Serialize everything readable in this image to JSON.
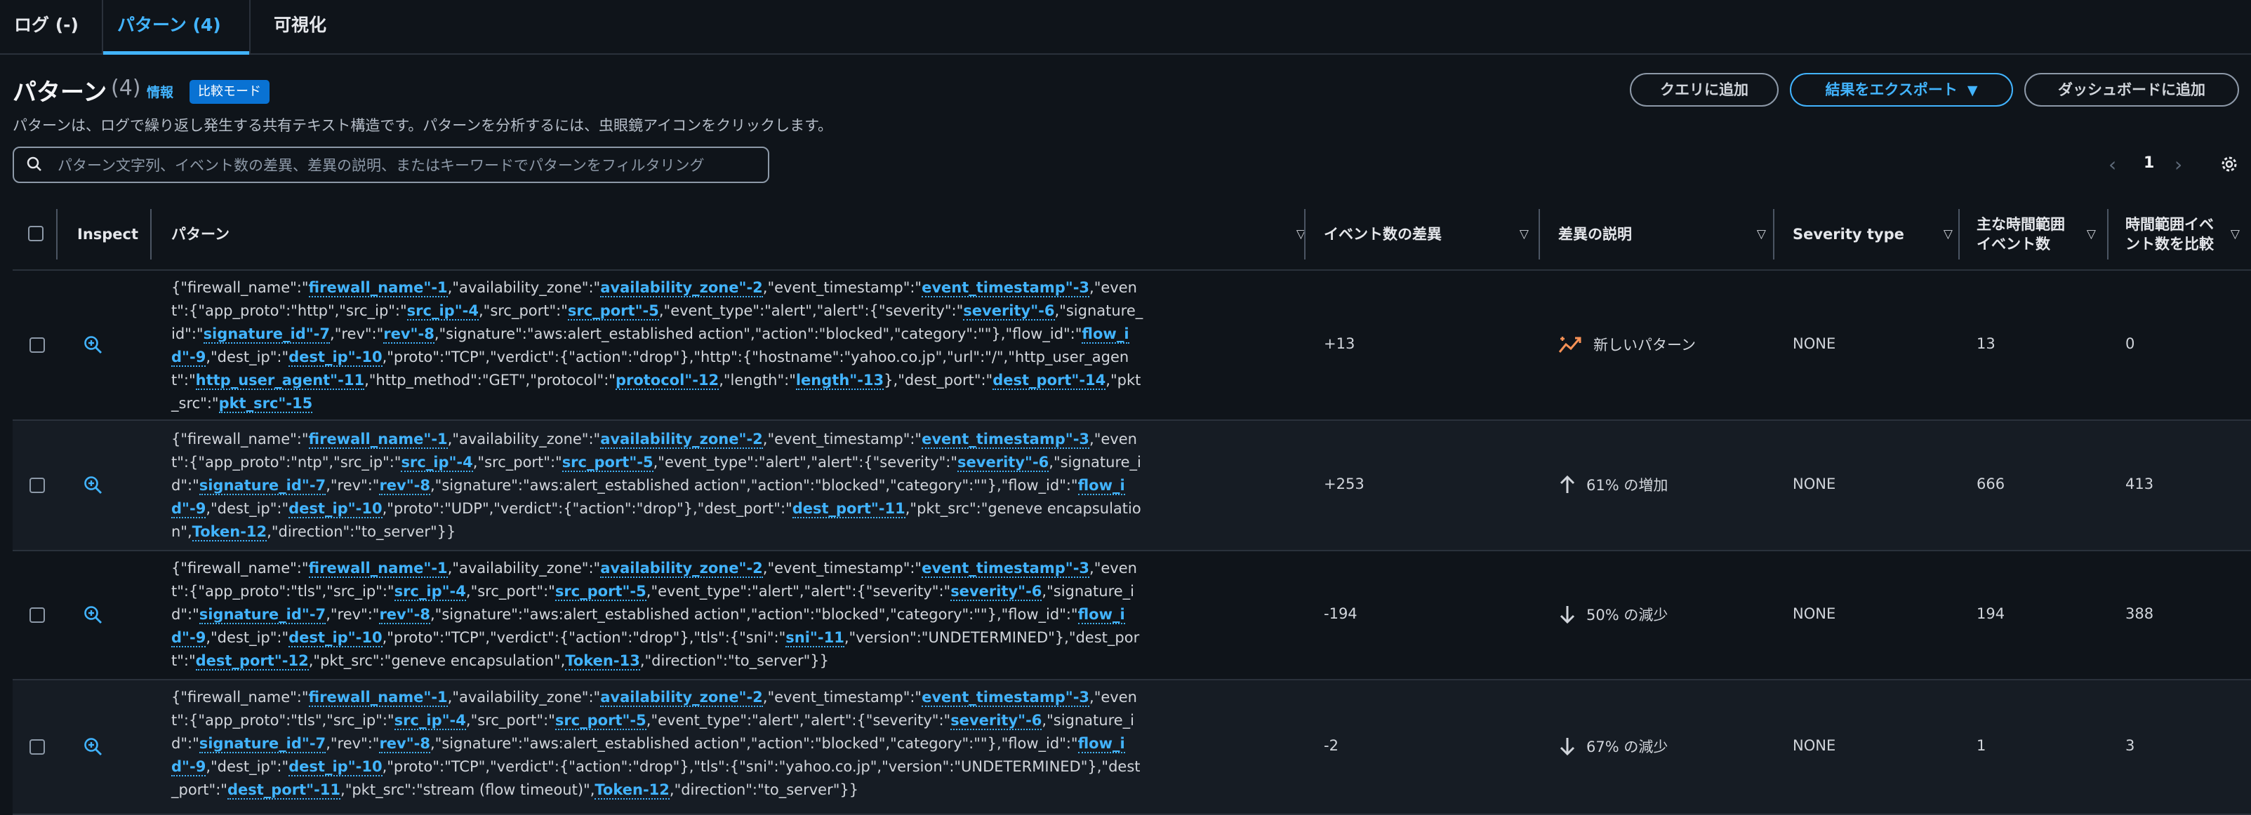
{
  "tabs": [
    {
      "label": "ログ (-)"
    },
    {
      "label": "パターン (4)"
    },
    {
      "label": "可視化"
    }
  ],
  "header": {
    "title": "パターン",
    "count": "(4)",
    "info": "情報",
    "compare_badge": "比較モード",
    "description": "パターンは、ログで繰り返し発生する共有テキスト構造です。パターンを分析するには、虫眼鏡アイコンをクリックします。"
  },
  "actions": {
    "add_query": "クエリに追加",
    "export": "結果をエクスポート",
    "add_dashboard": "ダッシュボードに追加"
  },
  "search": {
    "placeholder": "パターン文字列、イベント数の差異、差異の説明、またはキーワードでパターンをフィルタリング"
  },
  "pagination": {
    "current": "1"
  },
  "columns": {
    "inspect": "Inspect",
    "pattern": "パターン",
    "event_diff": "イベント数の差異",
    "diff_desc": "差異の説明",
    "severity": "Severity type",
    "main_count": "主な時間範囲イベント数",
    "compare_count": "時間範囲イベント数を比較"
  },
  "rows": [
    {
      "pattern": [
        {
          "t": "{\"firewall_name\":\""
        },
        {
          "k": "firewall_name\"-1"
        },
        {
          "t": ",\"availability_zone\":\""
        },
        {
          "k": "availability_zone\"-2"
        },
        {
          "t": ",\"event_timestamp\":\""
        },
        {
          "k": "event_timestamp\"-3"
        },
        {
          "t": ",\"event\":{\"app_proto\":\"http\",\"src_ip\":\""
        },
        {
          "k": "src_ip\"-4"
        },
        {
          "t": ",\"src_port\":\""
        },
        {
          "k": "src_port\"-5"
        },
        {
          "t": ",\"event_type\":\"alert\",\"alert\":{\"severity\":\""
        },
        {
          "k": "severity\"-6"
        },
        {
          "t": ",\"signature_id\":\""
        },
        {
          "k": "signature_id\"-7"
        },
        {
          "t": ",\"rev\":\""
        },
        {
          "k": "rev\"-8"
        },
        {
          "t": ",\"signature\":\"aws:alert_established action\",\"action\":\"blocked\",\"category\":\"\"},\"flow_id\":\""
        },
        {
          "k": "flow_id\"-9"
        },
        {
          "t": ",\"dest_ip\":\""
        },
        {
          "k": "dest_ip\"-10"
        },
        {
          "t": ",\"proto\":\"TCP\",\"verdict\":{\"action\":\"drop\"},\"http\":{\"hostname\":\"yahoo.co.jp\",\"url\":\"/\",\"http_user_agent\":\""
        },
        {
          "k": "http_user_agent\"-11"
        },
        {
          "t": ",\"http_method\":\"GET\",\"protocol\":\""
        },
        {
          "k": "protocol\"-12"
        },
        {
          "t": ",\"length\":\""
        },
        {
          "k": "length\"-13"
        },
        {
          "t": "},\"dest_port\":\""
        },
        {
          "k": "dest_port\"-14"
        },
        {
          "t": ",\"pkt_src\":\""
        },
        {
          "k": "pkt_src\"-15"
        }
      ],
      "event_diff": "+13",
      "trend": "new",
      "diff_desc": "新しいパターン",
      "severity": "NONE",
      "main_count": "13",
      "compare_count": "0"
    },
    {
      "pattern": [
        {
          "t": "{\"firewall_name\":\""
        },
        {
          "k": "firewall_name\"-1"
        },
        {
          "t": ",\"availability_zone\":\""
        },
        {
          "k": "availability_zone\"-2"
        },
        {
          "t": ",\"event_timestamp\":\""
        },
        {
          "k": "event_timestamp\"-3"
        },
        {
          "t": ",\"event\":{\"app_proto\":\"ntp\",\"src_ip\":\""
        },
        {
          "k": "src_ip\"-4"
        },
        {
          "t": ",\"src_port\":\""
        },
        {
          "k": "src_port\"-5"
        },
        {
          "t": ",\"event_type\":\"alert\",\"alert\":{\"severity\":\""
        },
        {
          "k": "severity\"-6"
        },
        {
          "t": ",\"signature_id\":\""
        },
        {
          "k": "signature_id\"-7"
        },
        {
          "t": ",\"rev\":\""
        },
        {
          "k": "rev\"-8"
        },
        {
          "t": ",\"signature\":\"aws:alert_established action\",\"action\":\"blocked\",\"category\":\"\"},\"flow_id\":\""
        },
        {
          "k": "flow_id\"-9"
        },
        {
          "t": ",\"dest_ip\":\""
        },
        {
          "k": "dest_ip\"-10"
        },
        {
          "t": ",\"proto\":\"UDP\",\"verdict\":{\"action\":\"drop\"},\"dest_port\":\""
        },
        {
          "k": "dest_port\"-11"
        },
        {
          "t": ",\"pkt_src\":\"geneve encapsulation\","
        },
        {
          "k": "Token-12"
        },
        {
          "t": ",\"direction\":\"to_server\"}}"
        }
      ],
      "event_diff": "+253",
      "trend": "up",
      "diff_desc": "61% の増加",
      "severity": "NONE",
      "main_count": "666",
      "compare_count": "413"
    },
    {
      "pattern": [
        {
          "t": "{\"firewall_name\":\""
        },
        {
          "k": "firewall_name\"-1"
        },
        {
          "t": ",\"availability_zone\":\""
        },
        {
          "k": "availability_zone\"-2"
        },
        {
          "t": ",\"event_timestamp\":\""
        },
        {
          "k": "event_timestamp\"-3"
        },
        {
          "t": ",\"event\":{\"app_proto\":\"tls\",\"src_ip\":\""
        },
        {
          "k": "src_ip\"-4"
        },
        {
          "t": ",\"src_port\":\""
        },
        {
          "k": "src_port\"-5"
        },
        {
          "t": ",\"event_type\":\"alert\",\"alert\":{\"severity\":\""
        },
        {
          "k": "severity\"-6"
        },
        {
          "t": ",\"signature_id\":\""
        },
        {
          "k": "signature_id\"-7"
        },
        {
          "t": ",\"rev\":\""
        },
        {
          "k": "rev\"-8"
        },
        {
          "t": ",\"signature\":\"aws:alert_established action\",\"action\":\"blocked\",\"category\":\"\"},\"flow_id\":\""
        },
        {
          "k": "flow_id\"-9"
        },
        {
          "t": ",\"dest_ip\":\""
        },
        {
          "k": "dest_ip\"-10"
        },
        {
          "t": ",\"proto\":\"TCP\",\"verdict\":{\"action\":\"drop\"},\"tls\":{\"sni\":\""
        },
        {
          "k": "sni\"-11"
        },
        {
          "t": ",\"version\":\"UNDETERMINED\"},\"dest_port\":\""
        },
        {
          "k": "dest_port\"-12"
        },
        {
          "t": ",\"pkt_src\":\"geneve encapsulation\","
        },
        {
          "k": "Token-13"
        },
        {
          "t": ",\"direction\":\"to_server\"}}"
        }
      ],
      "event_diff": "-194",
      "trend": "down",
      "diff_desc": "50% の減少",
      "severity": "NONE",
      "main_count": "194",
      "compare_count": "388"
    },
    {
      "pattern": [
        {
          "t": "{\"firewall_name\":\""
        },
        {
          "k": "firewall_name\"-1"
        },
        {
          "t": ",\"availability_zone\":\""
        },
        {
          "k": "availability_zone\"-2"
        },
        {
          "t": ",\"event_timestamp\":\""
        },
        {
          "k": "event_timestamp\"-3"
        },
        {
          "t": ",\"event\":{\"app_proto\":\"tls\",\"src_ip\":\""
        },
        {
          "k": "src_ip\"-4"
        },
        {
          "t": ",\"src_port\":\""
        },
        {
          "k": "src_port\"-5"
        },
        {
          "t": ",\"event_type\":\"alert\",\"alert\":{\"severity\":\""
        },
        {
          "k": "severity\"-6"
        },
        {
          "t": ",\"signature_id\":\""
        },
        {
          "k": "signature_id\"-7"
        },
        {
          "t": ",\"rev\":\""
        },
        {
          "k": "rev\"-8"
        },
        {
          "t": ",\"signature\":\"aws:alert_established action\",\"action\":\"blocked\",\"category\":\"\"},\"flow_id\":\""
        },
        {
          "k": "flow_id\"-9"
        },
        {
          "t": ",\"dest_ip\":\""
        },
        {
          "k": "dest_ip\"-10"
        },
        {
          "t": ",\"proto\":\"TCP\",\"verdict\":{\"action\":\"drop\"},\"tls\":{\"sni\":\"yahoo.co.jp\",\"version\":\"UNDETERMINED\"},\"dest_port\":\""
        },
        {
          "k": "dest_port\"-11"
        },
        {
          "t": ",\"pkt_src\":\"stream (flow timeout)\","
        },
        {
          "k": "Token-12"
        },
        {
          "t": ",\"direction\":\"to_server\"}}"
        }
      ],
      "event_diff": "-2",
      "trend": "down",
      "diff_desc": "67% の減少",
      "severity": "NONE",
      "main_count": "1",
      "compare_count": "3"
    }
  ],
  "colors": {
    "accent": "#42b4ff",
    "background": "#0f141a",
    "new_pattern": "#f89256"
  }
}
